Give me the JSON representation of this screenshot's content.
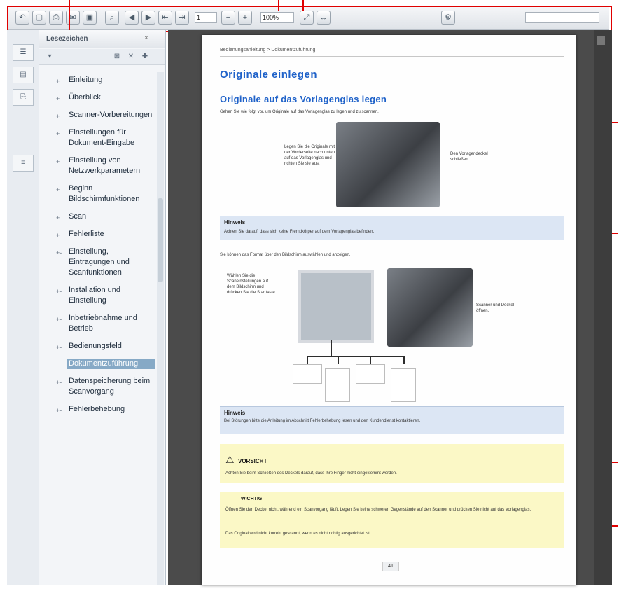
{
  "toolbar": {
    "page_value": "1",
    "zoom_value": "100%",
    "icons": [
      "back-icon",
      "open-icon",
      "print-icon",
      "email-icon",
      "save-icon",
      "search-icon",
      "prev-page-icon",
      "next-page-icon",
      "first-page-icon",
      "last-page-icon",
      "zoom-out-icon",
      "zoom-in-icon",
      "fit-page-icon",
      "fit-width-icon",
      "tools-icon"
    ]
  },
  "bookmarks": {
    "header": "Lesezeichen",
    "items": [
      {
        "label": "Einleitung",
        "expander": "+"
      },
      {
        "label": "Überblick",
        "expander": "+"
      },
      {
        "label": "Scanner-Vorbereitungen",
        "expander": "+"
      },
      {
        "label": "Einstellungen für Dokument-Eingabe",
        "expander": "+"
      },
      {
        "label": "Einstellung von Netzwerkparametern",
        "expander": "+"
      },
      {
        "label": "Beginn Bildschirmfunktionen",
        "expander": "+"
      },
      {
        "label": "Scan",
        "expander": "+"
      },
      {
        "label": "Fehlerliste",
        "expander": "+"
      },
      {
        "label": "Einstellung, Eintragungen und Scanfunktionen",
        "expander": "+-"
      },
      {
        "label": "Installation und Einstellung",
        "expander": "+-"
      },
      {
        "label": "Inbetriebnahme und Betrieb",
        "expander": "+-"
      },
      {
        "label": "Bedienungsfeld",
        "expander": "+-"
      },
      {
        "label": "Dokumentzuführung",
        "expander": "+-",
        "selected": true
      },
      {
        "label": "Datenspeicherung beim Scanvorgang",
        "expander": "+-"
      },
      {
        "label": "Fehlerbehebung",
        "expander": "+-"
      }
    ]
  },
  "page": {
    "breadcrumb": "Bedienungsanleitung > Dokumentzuführung",
    "title": "Originale einlegen",
    "subtitle": "Originale auf das Vorlagenglas legen",
    "intro": "Gehen Sie wie folgt vor, um Originale auf das Vorlagenglas zu legen und zu scannen.",
    "callout_left_1": "Legen Sie die Originale mit der Vorderseite nach unten auf das Vorlagenglas und richten Sie sie aus.",
    "callout_right_1": "Den Vorlagendeckel schließen.",
    "note1_label": "Hinweis",
    "note1_text": "Achten Sie darauf, dass sich keine Fremdkörper auf dem Vorlagenglas befinden.",
    "body_text": "Sie können das Format über den Bildschirm auswählen und anzeigen.",
    "callout_left_2": "Wählen Sie die Scaneinstellungen auf dem Bildschirm und drücken Sie die Starttaste.",
    "callout_right_2": "Scanner und Deckel öffnen.",
    "note2_label": "Hinweis",
    "note2_text": "Bei Störungen bitte die Anleitung im Abschnitt Fehlerbehebung lesen und den Kundendienst kontaktieren.",
    "warning_label": "VORSICHT",
    "warning_text": "Achten Sie beim Schließen des Deckels darauf, dass Ihre Finger nicht eingeklemmt werden.",
    "important_label": "WICHTIG",
    "important_text_1": "Öffnen Sie den Deckel nicht, während ein Scanvorgang läuft. Legen Sie keine schweren Gegenstände auf den Scanner und drücken Sie nicht auf das Vorlagenglas.",
    "important_text_2": "Das Original wird nicht korrekt gescannt, wenn es nicht richtig ausgerichtet ist.",
    "page_number": "41"
  }
}
